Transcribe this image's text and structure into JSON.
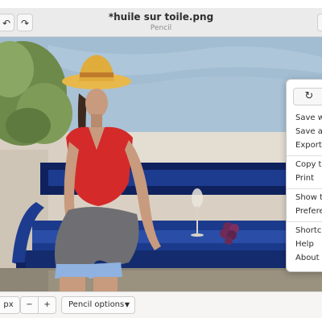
{
  "window": {
    "title": "*huile sur toile.png",
    "subtitle": "Pencil"
  },
  "headerbar": {
    "undo_icon": "↶",
    "redo_icon": "↷"
  },
  "bottombar": {
    "unit_label": "px",
    "minus_label": "−",
    "plus_label": "+",
    "options_label": "Pencil options",
    "options_arrow": "▼"
  },
  "popover": {
    "refresh_icon": "↻",
    "items": [
      "Save wi",
      "Save as",
      "Export a",
      "Copy to",
      "Print",
      "Show to",
      "Prefere",
      "Shortcu",
      "Help",
      "About D"
    ]
  },
  "colors": {
    "sky": "#a9c2d6",
    "shirt": "#d42a2a",
    "bench": "#1d3c8f",
    "hat": "#e8b84a"
  }
}
